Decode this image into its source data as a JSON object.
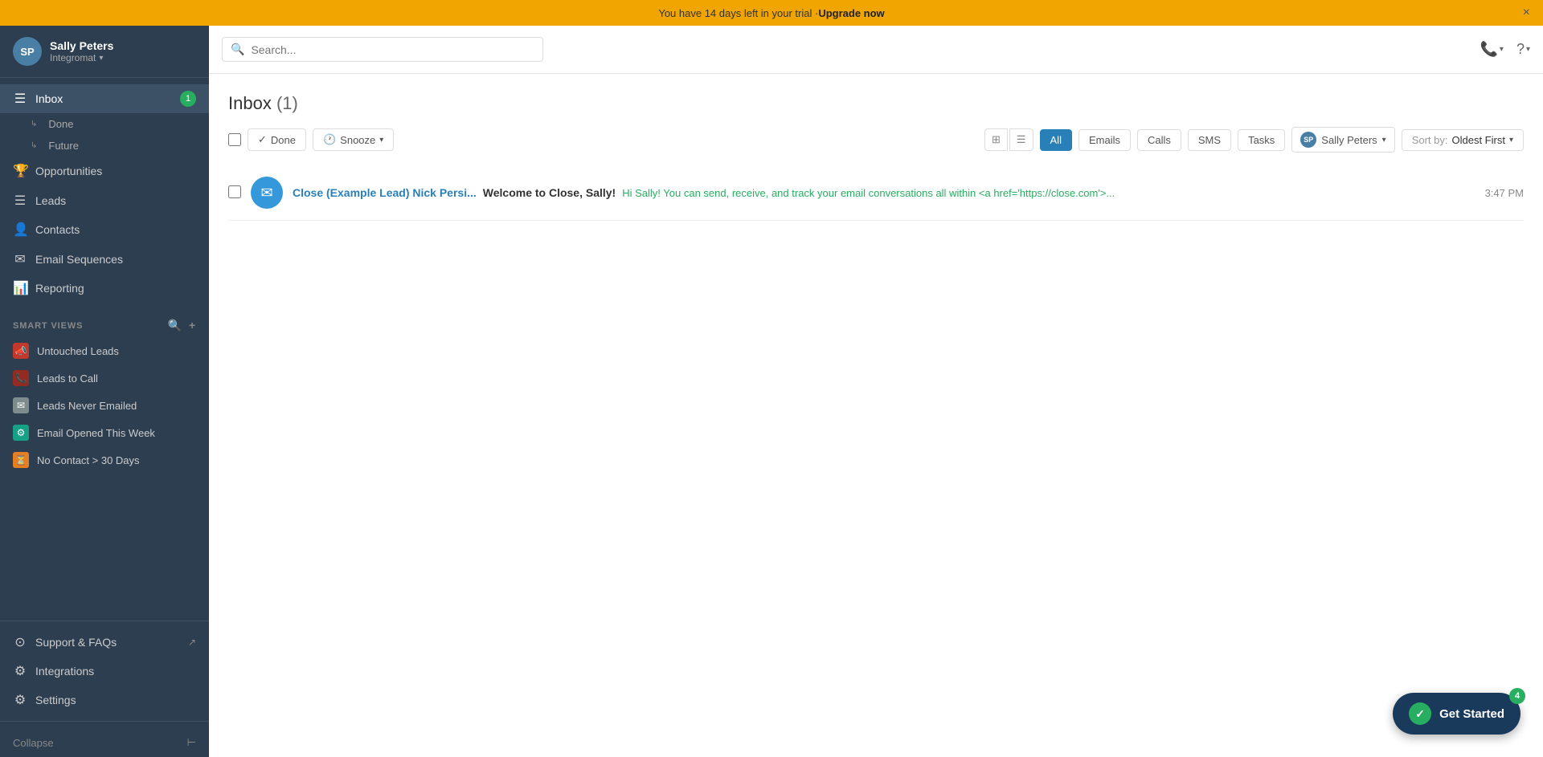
{
  "banner": {
    "text": "You have 14 days left in your trial · ",
    "upgrade_label": "Upgrade now",
    "close_label": "×"
  },
  "user": {
    "name": "Sally Peters",
    "org": "Integromat",
    "initials": "SP"
  },
  "search": {
    "placeholder": "Search..."
  },
  "nav": {
    "inbox_label": "Inbox",
    "inbox_badge": "1",
    "done_label": "Done",
    "future_label": "Future",
    "opportunities_label": "Opportunities",
    "leads_label": "Leads",
    "contacts_label": "Contacts",
    "email_sequences_label": "Email Sequences",
    "reporting_label": "Reporting",
    "support_label": "Support & FAQs",
    "integrations_label": "Integrations",
    "settings_label": "Settings",
    "collapse_label": "Collapse"
  },
  "smart_views": {
    "section_label": "SMART VIEWS",
    "items": [
      {
        "label": "Untouched Leads",
        "icon": "📣",
        "color": "sv-red"
      },
      {
        "label": "Leads to Call",
        "icon": "📞",
        "color": "sv-dark-red"
      },
      {
        "label": "Leads Never Emailed",
        "icon": "✉",
        "color": "sv-email"
      },
      {
        "label": "Email Opened This Week",
        "icon": "⚙",
        "color": "sv-teal"
      },
      {
        "label": "No Contact > 30 Days",
        "icon": "⏳",
        "color": "sv-orange"
      }
    ]
  },
  "inbox": {
    "title": "Inbox",
    "count": "(1)",
    "toolbar": {
      "done_label": "Done",
      "snooze_label": "Snooze",
      "filter_all": "All",
      "filter_emails": "Emails",
      "filter_calls": "Calls",
      "filter_sms": "SMS",
      "filter_tasks": "Tasks",
      "user_label": "Sally Peters",
      "sort_label": "Sort by:",
      "sort_value": "Oldest First"
    },
    "messages": [
      {
        "from": "Close (Example Lead)",
        "sender_name": "Nick Persi...",
        "subject": "Welcome to Close, Sally!",
        "preview": "Hi Sally! You can send, receive, and track your email conversations all within <a href='https://close.com'>...",
        "time": "3:47 PM"
      }
    ]
  },
  "get_started": {
    "label": "Get Started",
    "badge": "4"
  }
}
